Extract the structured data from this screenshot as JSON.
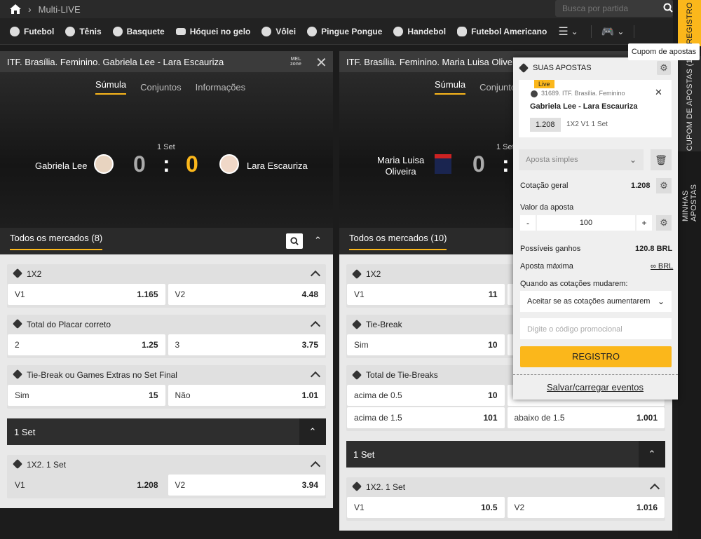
{
  "topbar": {
    "breadcrumb": "Multi-LIVE",
    "search_placeholder": "Busca por partida"
  },
  "sports": [
    "Futebol",
    "Tênis",
    "Basquete",
    "Hóquei no gelo",
    "Vôlei",
    "Pingue Pongue",
    "Handebol",
    "Futebol Americano"
  ],
  "rail": {
    "registro": "REGISTRO",
    "cupom": "CUPOM DE APOSTAS (1)",
    "minhas": "MINHAS APOSTAS"
  },
  "tooltip": "Cupom de apostas",
  "panel1": {
    "title": "ITF. Brasília. Feminino. Gabriela Lee - Lara Escauriza",
    "mel1": "MEL",
    "mel2": "zone",
    "tabs": [
      "Súmula",
      "Conjuntos",
      "Informações"
    ],
    "set": "1 Set",
    "p1": "Gabriela Lee",
    "p2": "Lara Escauriza",
    "s1": "0",
    "sep": ":",
    "s2": "0",
    "markets_label": "Todos os mercados",
    "markets_count": "(8)",
    "g1": {
      "title": "1X2",
      "a": "V1",
      "av": "1.165",
      "b": "V2",
      "bv": "4.48"
    },
    "g2": {
      "title": "Total do Placar correto",
      "a": "2",
      "av": "1.25",
      "b": "3",
      "bv": "3.75"
    },
    "g3": {
      "title": "Tie-Break ou Games Extras no Set Final",
      "a": "Sim",
      "av": "15",
      "b": "Não",
      "bv": "1.01"
    },
    "setbar": "1 Set",
    "g4": {
      "title": "1X2. 1 Set",
      "a": "V1",
      "av": "1.208",
      "b": "V2",
      "bv": "3.94"
    }
  },
  "panel2": {
    "title": "ITF. Brasília. Feminino. Maria Luisa Oliveira -",
    "tabs": [
      "Súmula",
      "Conjuntos"
    ],
    "set": "1 Set",
    "p1a": "Maria Luisa",
    "p1b": "Oliveira",
    "s1": "0",
    "sep": ":",
    "markets_label": "Todos os mercados",
    "markets_count": "(10)",
    "g1": {
      "title": "1X2",
      "a": "V1",
      "av": "11"
    },
    "g2": {
      "title": "Tie-Break",
      "a": "Sim",
      "av": "10"
    },
    "g3": {
      "title": "Total de Tie-Breaks",
      "a": "acima de 0.5",
      "av": "10",
      "c": "acima de 1.5",
      "cv": "101",
      "d": "abaixo de 1.5",
      "dv": "1.001"
    },
    "setbar": "1 Set",
    "g4": {
      "title": "1X2. 1 Set",
      "a": "V1",
      "av": "10.5",
      "b": "V2",
      "bv": "1.016"
    }
  },
  "slip": {
    "title": "SUAS APOSTAS",
    "live": "Live",
    "event": "31689. ITF. Brasília. Feminino",
    "match": "Gabriela Lee - Lara Escauriza",
    "odd": "1.208",
    "pick": "1X2 V1 1 Set",
    "type": "Aposta simples",
    "cot_label": "Cotação geral",
    "cot_value": "1.208",
    "valor_label": "Valor da aposta",
    "minus": "-",
    "amount": "100",
    "plus": "+",
    "ganhos_label": "Possíveis ganhos",
    "ganhos_value": "120.8 BRL",
    "max_label": "Aposta máxima",
    "max_value": "∞ BRL",
    "change_label": "Quando as cotações mudarem:",
    "change_value": "Aceitar se as cotações aumentarem",
    "promo_placeholder": "Digite o código promocional",
    "register": "REGISTRO",
    "save": "Salvar/carregar eventos"
  }
}
